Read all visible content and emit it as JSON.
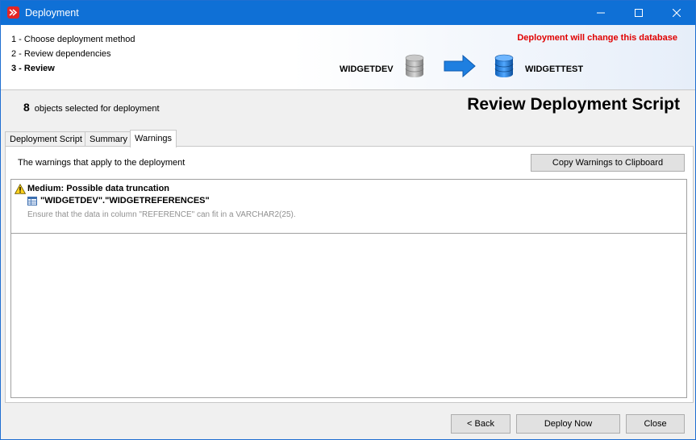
{
  "window": {
    "title": "Deployment"
  },
  "wizard": {
    "steps": [
      {
        "label": "1 - Choose deployment method"
      },
      {
        "label": "2 - Review dependencies"
      },
      {
        "label": "3 - Review"
      }
    ],
    "current_step": 3,
    "warning_banner": "Deployment will change this database",
    "source_db": "WIDGETDEV",
    "target_db": "WIDGETTEST"
  },
  "summary": {
    "object_count": "8",
    "object_text": "objects selected for deployment",
    "page_title": "Review Deployment Script"
  },
  "tabs": [
    {
      "label": "Deployment Script"
    },
    {
      "label": "Summary"
    },
    {
      "label": "Warnings"
    }
  ],
  "active_tab": "Warnings",
  "warnings_panel": {
    "caption": "The warnings that apply to the deployment",
    "copy_button": "Copy Warnings to Clipboard",
    "items": [
      {
        "title": "Medium: Possible data truncation",
        "object": "\"WIDGETDEV\".\"WIDGETREFERENCES\"",
        "description": "Ensure that the data in column \"REFERENCE\" can fit in a VARCHAR2(25)."
      }
    ]
  },
  "footer": {
    "back": "< Back",
    "deploy": "Deploy Now",
    "close": "Close"
  },
  "colors": {
    "titlebar": "#0f70d6",
    "warning_text": "#e00000",
    "arrow": "#1e7fe0"
  },
  "icons": [
    "app-logo-icon",
    "minimize-icon",
    "maximize-icon",
    "close-icon",
    "database-icon",
    "arrow-right-icon",
    "warning-icon",
    "table-icon"
  ]
}
